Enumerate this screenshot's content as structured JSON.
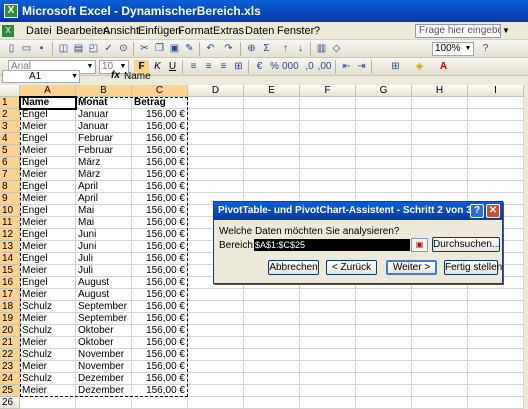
{
  "window": {
    "title": "Microsoft Excel - DynamischerBereich.xls",
    "app_icon": "X"
  },
  "menu": {
    "items": [
      "Datei",
      "Bearbeiten",
      "Ansicht",
      "Einfügen",
      "Format",
      "Extras",
      "Daten",
      "Fenster",
      "?"
    ],
    "help_placeholder": "Frage hier eingeben"
  },
  "toolbar": {
    "zoom": "100%",
    "font": "Arial",
    "font_size": "10"
  },
  "formula_bar": {
    "name_box": "A1",
    "fx": "fx",
    "content": "Name"
  },
  "sheet": {
    "columns": [
      "A",
      "B",
      "C",
      "D",
      "E",
      "F",
      "G",
      "H",
      "I"
    ],
    "row_numbers": [
      "1",
      "2",
      "3",
      "4",
      "5",
      "6",
      "7",
      "8",
      "9",
      "10",
      "11",
      "12",
      "13",
      "14",
      "15",
      "16",
      "17",
      "18",
      "19",
      "20",
      "21",
      "22",
      "23",
      "24",
      "25",
      "26"
    ],
    "rows": [
      [
        "Name",
        "Monat",
        "Betrag"
      ],
      [
        "Engel",
        "Januar",
        "156,00 €"
      ],
      [
        "Meier",
        "Januar",
        "156,00 €"
      ],
      [
        "Engel",
        "Februar",
        "156,00 €"
      ],
      [
        "Meier",
        "Februar",
        "156,00 €"
      ],
      [
        "Engel",
        "März",
        "156,00 €"
      ],
      [
        "Meier",
        "März",
        "156,00 €"
      ],
      [
        "Engel",
        "April",
        "156,00 €"
      ],
      [
        "Meier",
        "April",
        "156,00 €"
      ],
      [
        "Engel",
        "Mai",
        "156,00 €"
      ],
      [
        "Meier",
        "Mai",
        "156,00 €"
      ],
      [
        "Engel",
        "Juni",
        "156,00 €"
      ],
      [
        "Meier",
        "Juni",
        "156,00 €"
      ],
      [
        "Engel",
        "Juli",
        "156,00 €"
      ],
      [
        "Meier",
        "Juli",
        "156,00 €"
      ],
      [
        "Engel",
        "August",
        "156,00 €"
      ],
      [
        "Meier",
        "August",
        "156,00 €"
      ],
      [
        "Schulz",
        "September",
        "156,00 €"
      ],
      [
        "Meier",
        "September",
        "156,00 €"
      ],
      [
        "Schulz",
        "Oktober",
        "156,00 €"
      ],
      [
        "Meier",
        "Oktober",
        "156,00 €"
      ],
      [
        "Schulz",
        "November",
        "156,00 €"
      ],
      [
        "Meier",
        "November",
        "156,00 €"
      ],
      [
        "Schulz",
        "Dezember",
        "156,00 €"
      ],
      [
        "Meier",
        "Dezember",
        "156,00 €"
      ],
      [
        "",
        "",
        ""
      ]
    ]
  },
  "dialog": {
    "title": "PivotTable- und PivotChart-Assistent - Schritt 2 von 3",
    "help_glyph": "?",
    "close_glyph": "✕",
    "question": "Welche Daten möchten Sie analysieren?",
    "range_label": "Bereich:",
    "range_value": "$A$1:$C$25",
    "browse_label": "Durchsuchen...",
    "cancel_label": "Abbrechen",
    "back_label": "< Zurück",
    "next_label": "Weiter >",
    "finish_label": "Fertig stellen"
  },
  "colors": {
    "title_blue": "#0848b8",
    "selected_header": "#ffd38d",
    "excel_green": "#2d8a3e"
  },
  "icons": [
    "excel-icon",
    "new-icon",
    "open-icon",
    "save-icon",
    "print-icon",
    "cut-icon",
    "copy-icon",
    "paste-icon",
    "undo-icon",
    "redo-icon",
    "sum-icon",
    "sort-icon",
    "chart-icon",
    "help-icon",
    "bold-icon",
    "italic-icon",
    "underline-icon",
    "align-icon",
    "euro-icon",
    "percent-icon",
    "borders-icon",
    "fill-color-icon",
    "font-color-icon"
  ]
}
